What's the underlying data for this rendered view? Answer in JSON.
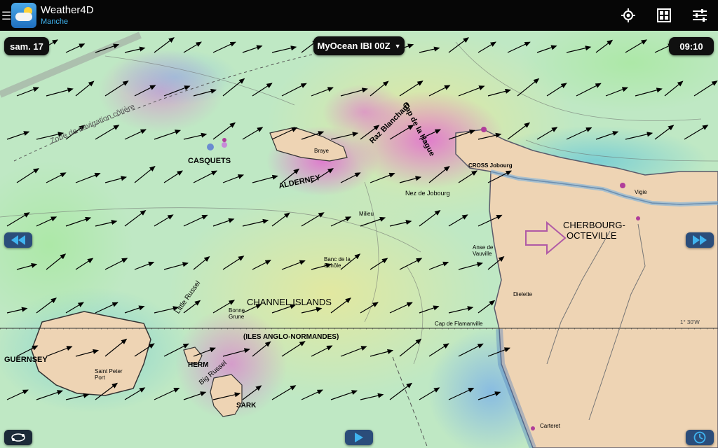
{
  "app": {
    "title": "Weather4D",
    "subtitle": "Manche"
  },
  "toolbar": {
    "icons": [
      "menu-icon",
      "locate-icon",
      "grid-icon",
      "settings-icon"
    ]
  },
  "controls": {
    "date": "sam. 17",
    "model": "MyOcean IBI 00Z",
    "time": "09:10",
    "prev_icon": "rewind-icon",
    "next_icon": "fast-forward-icon",
    "play_icon": "play-icon",
    "route_icon": "route-icon",
    "clock_icon": "clock-icon"
  },
  "map_labels": {
    "casquets": "CASQUETS",
    "alderney": "ALDERNEY",
    "raz_blanchard": "Raz Blanchard",
    "cap_hague": "Cap de la Hague",
    "cherbourg_1": "CHERBOURG-",
    "cherbourg_2": "OCTEVILLE",
    "channel_islands": "CHANNEL ISLANDS",
    "iles_anglo": "(ILES ANGLO-NORMANDES)",
    "guernsey": "GUERNSEY",
    "herm": "HERM",
    "sark": "SARK",
    "little_russel": "Little Russel",
    "big_russel": "Big Russel",
    "saint_peter_port": "Saint Peter Port",
    "nez_jobourg": "Nez de Jobourg",
    "cross_jobourg": "CROSS Jobourg",
    "anse_vauville": "Anse de Vauville",
    "bonne_grune": "Bonne Grune",
    "carteret": "Carteret",
    "zone_navigation": "Zone de navigation côtière",
    "longitude": "1° 30'W",
    "braye": "Braye",
    "dielette": "Dielette",
    "vigie": "Vigie",
    "milieu": "Milieu",
    "banc_schole": "Banc de la Schôle",
    "cap_flamanville": "Cap de Flamanville"
  },
  "colors": {
    "topbar": "#060606",
    "subtitle": "#3fb4f0",
    "sea_base": "#bfe8c4",
    "land": "#eed4b4",
    "current_strong": "#e070d0",
    "current_medium": "#86c6e2",
    "nav_button": "#2b4d7a"
  }
}
